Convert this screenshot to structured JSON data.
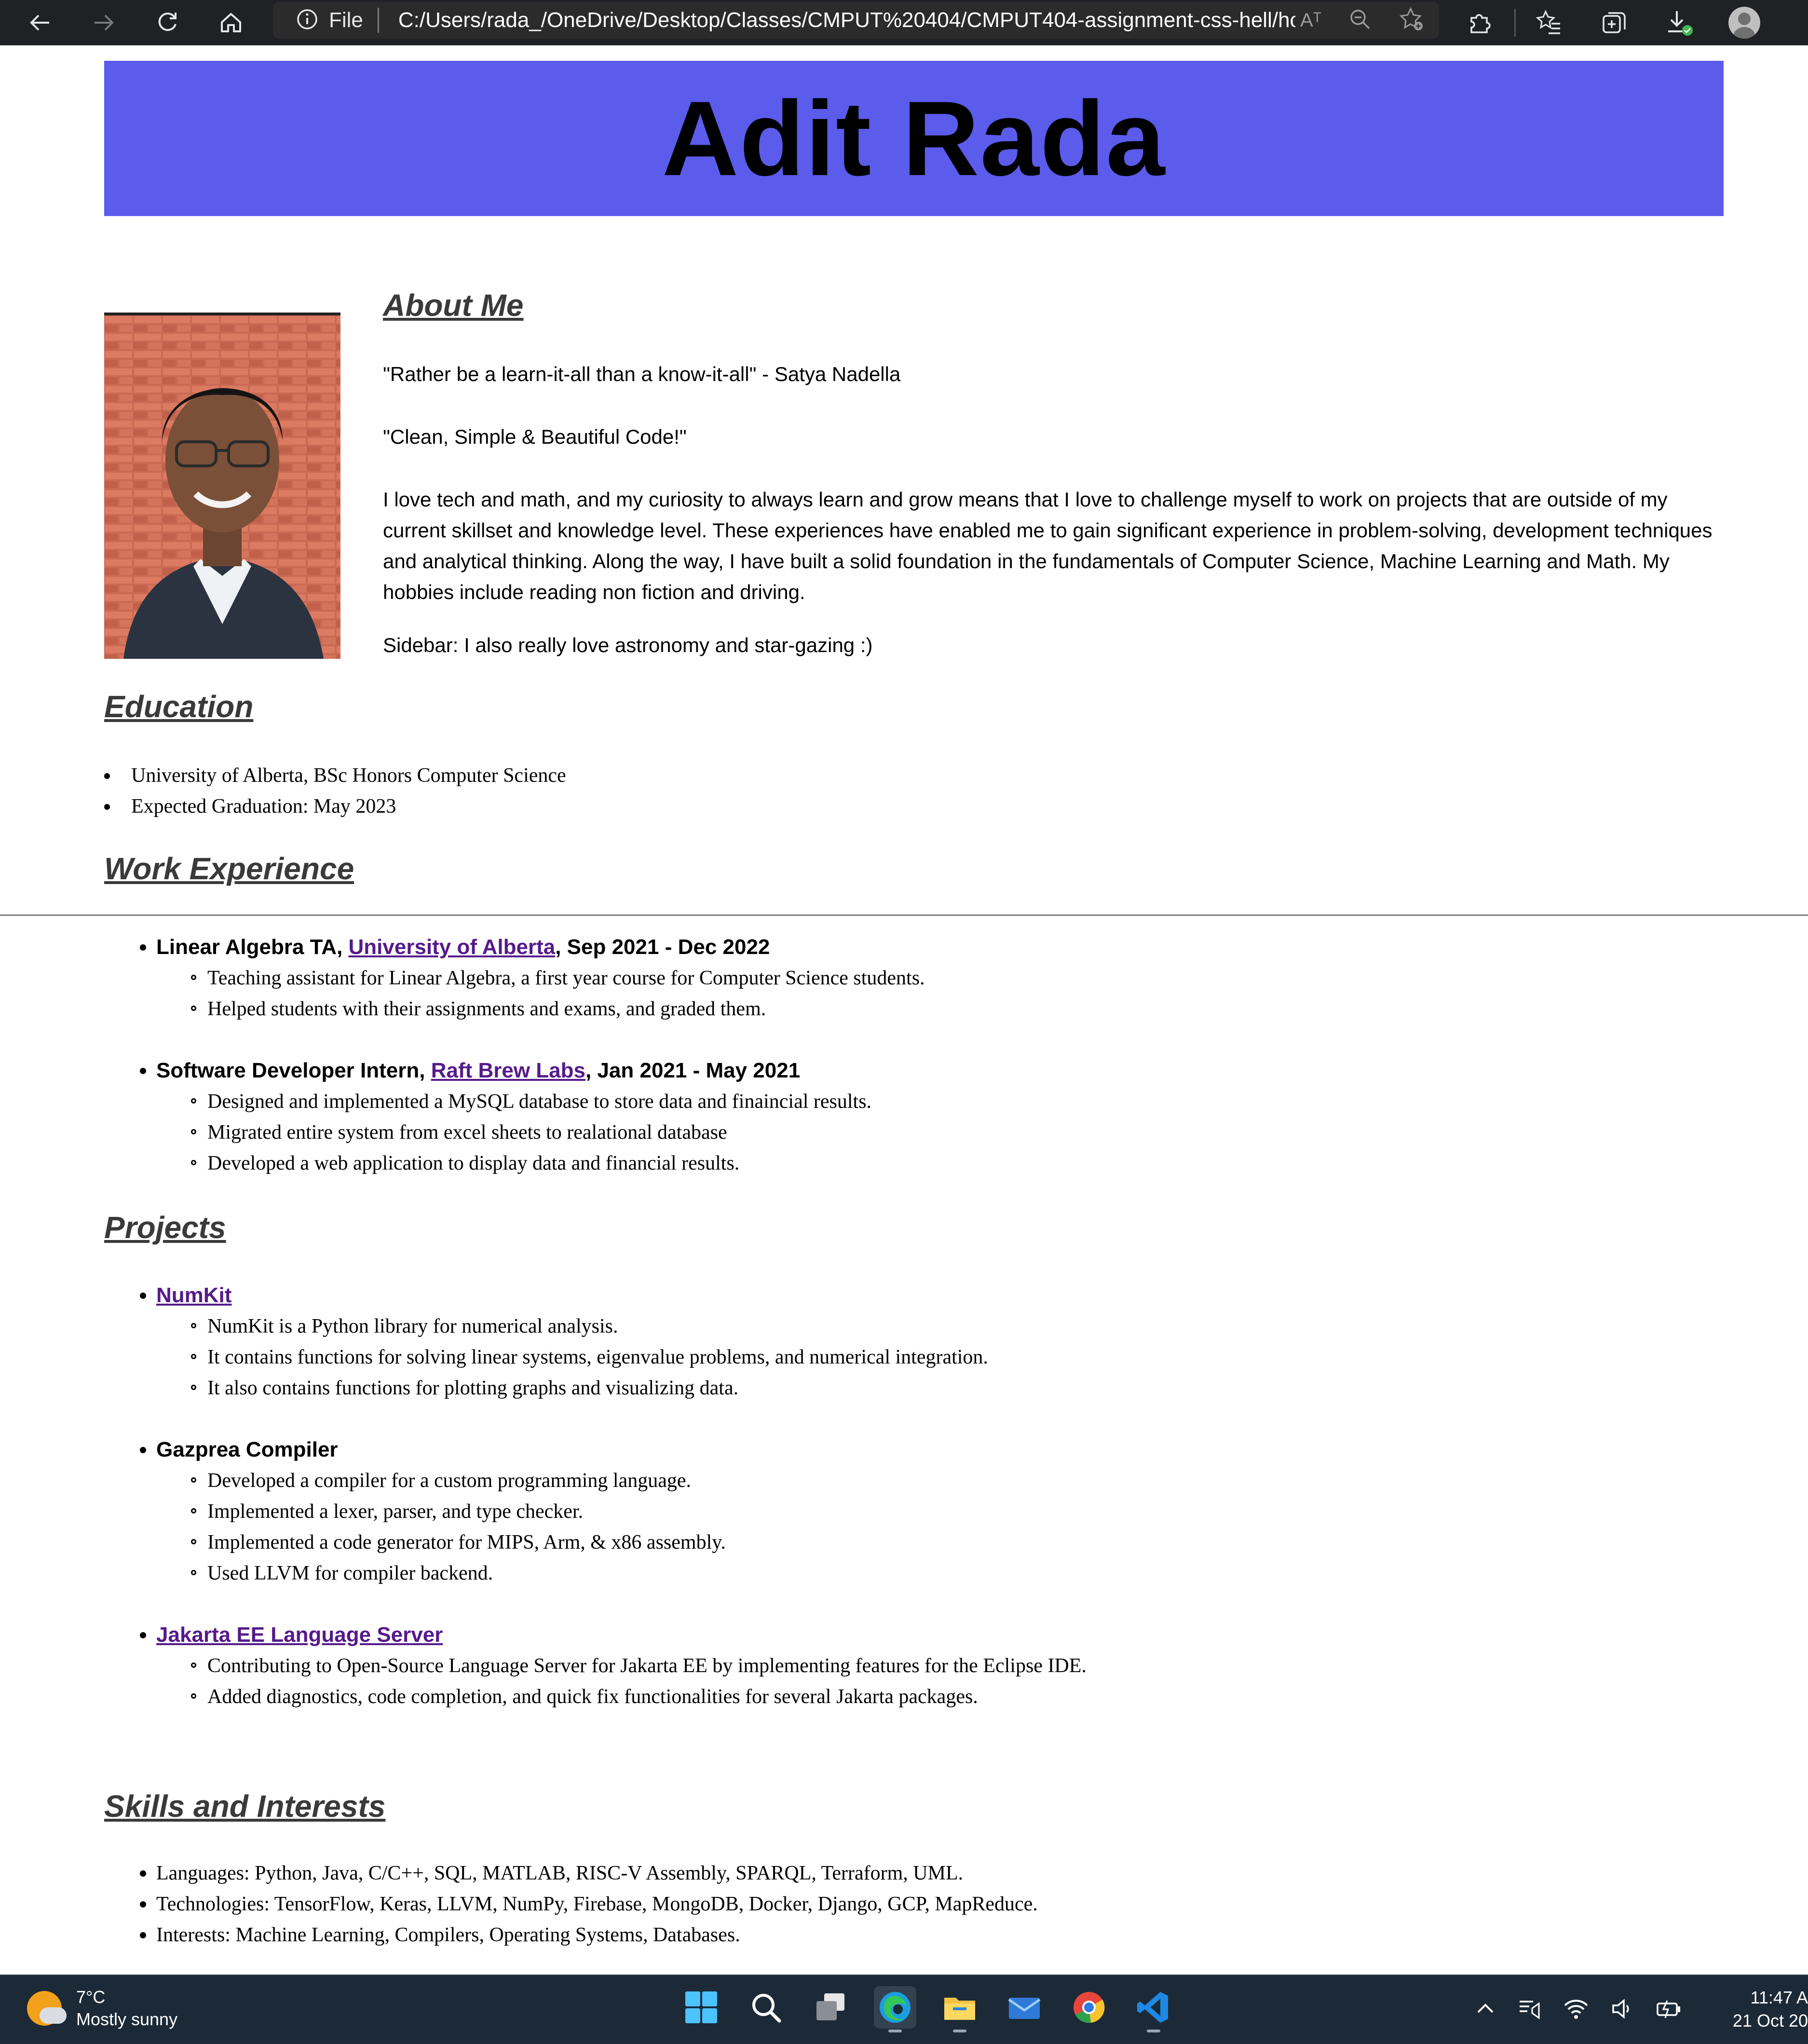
{
  "browser": {
    "address_label": "File",
    "url": "C:/Users/rada_/OneDrive/Desktop/Classes/CMPUT%20404/CMPUT404-assignment-css-hell/hom...",
    "read_aloud_glyph": "Aᵀ"
  },
  "header": {
    "name": "Adit Rada"
  },
  "about": {
    "title": "About Me",
    "quote1": "\"Rather be a learn-it-all than a know-it-all\" - Satya Nadella",
    "quote2": "\"Clean, Simple & Beautiful Code!\"",
    "paragraph": "I love tech and math, and my curiosity to always learn and grow means that I love to challenge myself to work on projects that are outside of my current skillset and knowledge level. These experiences have enabled me to gain significant experience in problem-solving, development techniques and analytical thinking. Along the way, I have built a solid foundation in the fundamentals of Computer Science, Machine Learning and Math. My hobbies include reading non fiction and driving.",
    "sidebar": "Sidebar: I also really love astronomy and star-gazing :)"
  },
  "education": {
    "title": "Education",
    "items": [
      "University of Alberta, BSc Honors Computer Science",
      "Expected Graduation: May 2023"
    ]
  },
  "work": {
    "title": "Work Experience",
    "jobs": [
      {
        "role": "Linear Algebra TA, ",
        "org": "University of Alberta",
        "dates": ", Sep 2021 - Dec 2022",
        "points": [
          "Teaching assistant for Linear Algebra, a first year course for Computer Science students.",
          "Helped students with their assignments and exams, and graded them."
        ]
      },
      {
        "role": "Software Developer Intern, ",
        "org": "Raft Brew Labs",
        "dates": ", Jan 2021 - May 2021",
        "points": [
          "Designed and implemented a MySQL database to store data and finaincial results.",
          "Migrated entire system from excel sheets to realational database",
          "Developed a web application to display data and financial results."
        ]
      }
    ]
  },
  "projects": {
    "title": "Projects",
    "items": [
      {
        "name": "NumKit",
        "points": [
          "NumKit is a Python library for numerical analysis.",
          "It contains functions for solving linear systems, eigenvalue problems, and numerical integration.",
          "It also contains functions for plotting graphs and visualizing data."
        ]
      },
      {
        "name": "Gazprea Compiler",
        "points": [
          "Developed a compiler for a custom programming language.",
          "Implemented a lexer, parser, and type checker.",
          "Implemented a code generator for MIPS, Arm, & x86 assembly.",
          "Used LLVM for compiler backend."
        ]
      },
      {
        "name": "Jakarta EE Language Server",
        "points": [
          "Contributing to Open-Source Language Server for Jakarta EE by implementing features for the Eclipse IDE.",
          "Added diagnostics, code completion, and quick fix functionalities for several Jakarta packages."
        ]
      }
    ]
  },
  "skills": {
    "title": "Skills and Interests",
    "items": [
      "Languages: Python, Java, C/C++, SQL, MATLAB, RISC-V Assembly, SPARQL, Terraform, UML.",
      "Technologies: TensorFlow, Keras, LLVM, NumPy, Firebase, MongoDB, Docker, Django, GCP, MapReduce.",
      "Interests: Machine Learning, Compilers, Operating Systems, Databases."
    ]
  },
  "taskbar": {
    "temperature": "7°C",
    "condition": "Mostly sunny",
    "time": "11:47 A",
    "date": "21 Oct 20"
  },
  "colors": {
    "banner": "#5b5bec",
    "link": "#551a8b",
    "heading": "#3a3a3a",
    "taskbar": "#1c2a38"
  }
}
